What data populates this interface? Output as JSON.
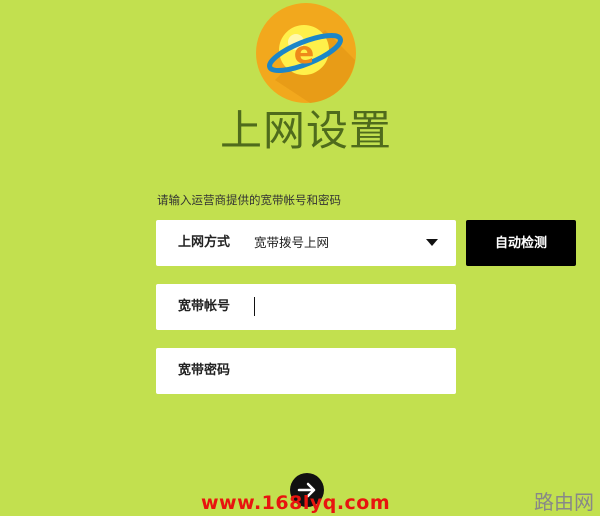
{
  "page_title": "上网设置",
  "hint_text": "请输入运营商提供的宽带帐号和密码",
  "connection_type": {
    "label": "上网方式",
    "value": "宽带拨号上网"
  },
  "auto_detect_label": "自动检测",
  "account": {
    "label": "宽带帐号",
    "value": ""
  },
  "password": {
    "label": "宽带密码",
    "value": ""
  },
  "next_icon": "arrow-right-icon",
  "logo_icon": "internet-explorer-globe-icon",
  "watermark": {
    "url": "www.168lyq.com",
    "site": "路由网"
  },
  "colors": {
    "background": "#c2e04f",
    "title": "#4f6b1c",
    "logo_circle": "#f2a81d",
    "button": "#000000",
    "watermark_url": "#e8140f"
  }
}
